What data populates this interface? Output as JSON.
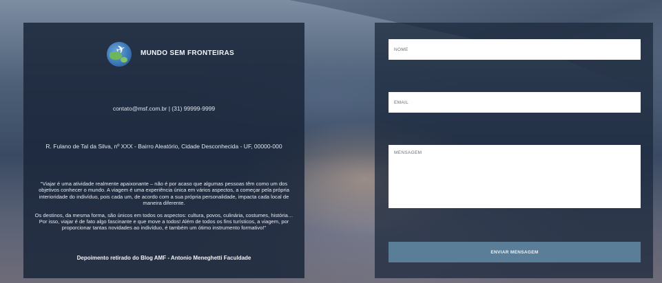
{
  "brand": {
    "name": "MUNDO SEM FRONTEIRAS",
    "logo_icon": "globe-plane-icon"
  },
  "contact": {
    "text": "contato@msf.com.br   |   (31) 99999-9999"
  },
  "address": {
    "text": "R. Fulano de Tal da Silva, nº XXX - Bairro Aleatório, Cidade Desconhecida - UF, 00000-000"
  },
  "quote": {
    "paragraph1": "\"Viajar é uma atividade realmente apaixonante – não é por acaso que algumas pessoas têm como um dos objetivos conhecer o mundo. A viagem é uma experiência única em vários aspectos, a começar pela própria interioridade do indivíduo, pois cada um, de acordo com a sua própria personalidade, impacta cada local de maneira diferente.",
    "paragraph2": "Os destinos, da mesma forma, são únicos em todos os aspectos: cultura, povos, culinária, costumes, história… Por isso, viajar é de fato algo fascinante e que move a todos! Além de todos os fins turísticos, a viagem, por proporcionar tantas novidades ao indivíduo, é também um ótimo instrumento formativo!\"",
    "credit": "Depoimento retirado do  Blog AMF  - Antonio Meneghetti Faculdade"
  },
  "form": {
    "name_placeholder": "NOME",
    "email_placeholder": "EMAIL",
    "message_placeholder": "MENSAGEM",
    "submit_label": "ENVIAR MENSAGEM"
  },
  "colors": {
    "panel": "#1b273a",
    "button": "#5b7e98",
    "field": "#ffffff"
  }
}
